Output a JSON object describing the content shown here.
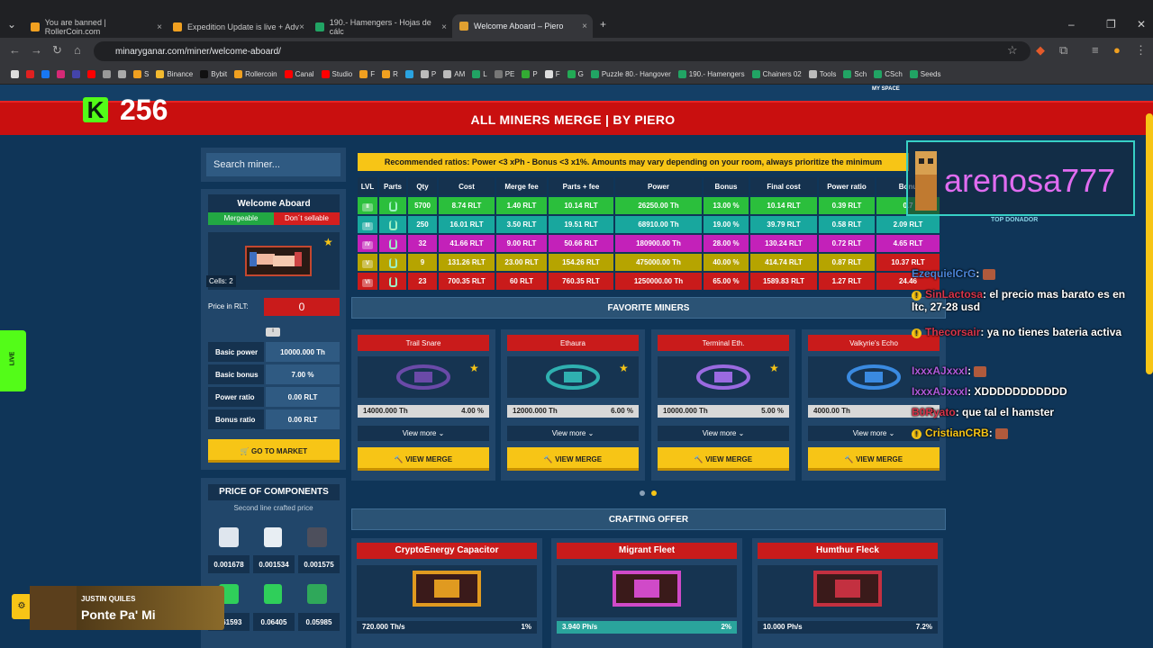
{
  "browser": {
    "tabs": [
      {
        "title": "You are banned | RollerCoin.com",
        "active": false
      },
      {
        "title": "Expedition Update is live + Adv",
        "active": false
      },
      {
        "title": "190.- Hamengers - Hojas de cálc",
        "active": false
      },
      {
        "title": "Welcome Aboard – Piero",
        "active": true
      }
    ],
    "url": "minaryganar.com/miner/welcome-aboard/",
    "bookmarks": [
      "S",
      "Binance",
      "Bybit",
      "Rollercoin",
      "Canal",
      "Studio",
      "F",
      "R",
      "P",
      "AM",
      "L",
      "PE",
      "P",
      "F",
      "G",
      "Puzzle 80.- Hangover",
      "190.- Hamengers",
      "Chainers 02",
      "Tools",
      "Sch",
      "CSch",
      "Seeds"
    ]
  },
  "overlay": {
    "kick_count": "256",
    "live_label": "LIVE",
    "donor_name": "arenosa777",
    "donor_label": "TOP DONADOR",
    "chat": [
      {
        "user": "EzequielCrG",
        "message": ":",
        "badge": false,
        "emote": true,
        "user_color": "#4a84d8"
      },
      {
        "user": "SinLactosa",
        "message": ": el precio mas barato es en ltc, 27-28 usd",
        "badge": true,
        "emote": false,
        "user_color": "#d8344a"
      },
      {
        "user": "Thecorsair",
        "message": ": ya no tienes bateria activa",
        "badge": true,
        "emote": false,
        "user_color": "#d8344a"
      },
      {
        "user": "IxxxAJxxxI",
        "message": ":",
        "badge": false,
        "emote": true,
        "user_color": "#b05adb"
      },
      {
        "user": "IxxxAJxxxI",
        "message": ": XDDDDDDDDDDD",
        "badge": false,
        "emote": false,
        "user_color": "#b05adb"
      },
      {
        "user": "B0Ryato",
        "message": ": que tal el hamster",
        "badge": false,
        "emote": false,
        "user_color": "#d8344a"
      },
      {
        "user": "CristianCRB",
        "message": ":",
        "badge": true,
        "emote": true,
        "user_color": "#f7c516"
      }
    ],
    "music": {
      "artist": "JUSTIN QUILES",
      "song": "Ponte Pa' Mi"
    }
  },
  "page": {
    "myspace": "MY SPACE",
    "title": "ALL MINERS MERGE | BY PIERO",
    "search_placeholder": "Search miner...",
    "miner": {
      "name": "Welcome Aboard",
      "mergeable": "Mergeable",
      "sellable": "Don´t sellable",
      "cells": "Cells: 2",
      "price_label": "Price in RLT:",
      "price_value": "0",
      "stats": [
        {
          "label": "Basic power",
          "value": "10000.000 Th"
        },
        {
          "label": "Basic bonus",
          "value": "7.00 %"
        },
        {
          "label": "Power ratio",
          "value": "0.00 RLT"
        },
        {
          "label": "Bonus ratio",
          "value": "0.00 RLT"
        }
      ],
      "market_button": "GO TO MARKET"
    },
    "components": {
      "title": "PRICE OF COMPONENTS",
      "subtitle": "Second line crafted price",
      "row1": [
        "0.001678",
        "0.001534",
        "0.001575"
      ],
      "row2": [
        "0.61593",
        "0.06405",
        "0.05985"
      ]
    },
    "ratio_note": "Recommended ratios: Power <3 xPh - Bonus <3 x1%. Amounts may vary depending on your room, always prioritize the minimum",
    "table": {
      "headers": [
        "LVL",
        "Parts",
        "Qty",
        "Cost",
        "Merge fee",
        "Parts + fee",
        "Power",
        "Bonus",
        "Final cost",
        "Power ratio",
        "Bonu"
      ],
      "rows": [
        {
          "lvl": "II",
          "color": "#2bbf3c",
          "cells": [
            "5700",
            "8.74 RLT",
            "1.40 RLT",
            "10.14 RLT",
            "26250.00 Th",
            "13.00 %",
            "10.14 RLT",
            "0.39 RLT",
            "0.7"
          ]
        },
        {
          "lvl": "III",
          "color": "#18a79e",
          "cells": [
            "250",
            "16.01 RLT",
            "3.50 RLT",
            "19.51 RLT",
            "68910.00 Th",
            "19.00 %",
            "39.79 RLT",
            "0.58 RLT",
            "2.09 RLT"
          ]
        },
        {
          "lvl": "IV",
          "color": "#c321b9",
          "cells": [
            "32",
            "41.66 RLT",
            "9.00 RLT",
            "50.66 RLT",
            "180900.00 Th",
            "28.00 %",
            "130.24 RLT",
            "0.72 RLT",
            "4.65 RLT"
          ]
        },
        {
          "lvl": "V",
          "color": "#b6a400",
          "cells": [
            "9",
            "131.26 RLT",
            "23.00 RLT",
            "154.26 RLT",
            "475000.00 Th",
            "40.00 %",
            "414.74 RLT",
            "0.87 RLT",
            "10.37 RLT"
          ]
        },
        {
          "lvl": "VI",
          "color": "#c91b1b",
          "cells": [
            "23",
            "700.35 RLT",
            "60 RLT",
            "760.35 RLT",
            "1250000.00 Th",
            "65.00 %",
            "1589.83 RLT",
            "1.27 RLT",
            "24.46"
          ]
        }
      ]
    },
    "favorites": {
      "title": "FAVORITE MINERS",
      "items": [
        {
          "name": "Trail Snare",
          "power": "14000.000 Th",
          "bonus": "4.00 %",
          "more": "View more",
          "merge": "VIEW MERGE"
        },
        {
          "name": "Ethaura",
          "power": "12000.000 Th",
          "bonus": "6.00 %",
          "more": "View more",
          "merge": "VIEW MERGE"
        },
        {
          "name": "Terminal Eth.",
          "power": "10000.000 Th",
          "bonus": "5.00 %",
          "more": "View more",
          "merge": "VIEW MERGE"
        },
        {
          "name": "Valkyrie's Echo",
          "power": "4000.00 Th",
          "bonus": "3",
          "more": "View more",
          "merge": "VIEW MERGE"
        }
      ]
    },
    "crafting": {
      "title": "CRAFTING OFFER",
      "items": [
        {
          "name": "CryptoEnergy Capacitor",
          "power": "720.000 Th/s",
          "bonus": "1%"
        },
        {
          "name": "Migrant Fleet",
          "power": "3.940 Ph/s",
          "bonus": "2%"
        },
        {
          "name": "Humthur Fleck",
          "power": "10.000 Ph/s",
          "bonus": "7.2%"
        }
      ]
    }
  }
}
